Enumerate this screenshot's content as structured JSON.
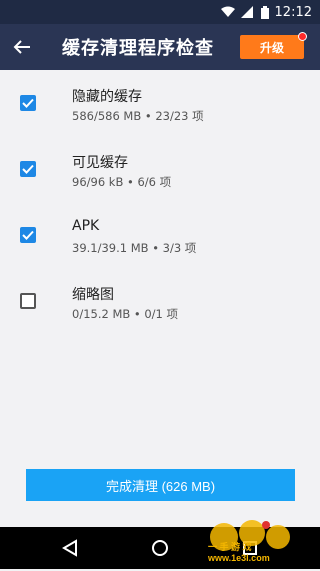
{
  "status_bar": {
    "time": "12:12",
    "icons": [
      "wifi-icon",
      "signal-icon",
      "battery-icon"
    ]
  },
  "header": {
    "back_icon": "arrow-left-icon",
    "title": "缓存清理程序检查",
    "upgrade_label": "升级"
  },
  "items": [
    {
      "title": "隐藏的缓存",
      "subtitle": "586/586 MB • 23/23 项",
      "checked": true
    },
    {
      "title": "可见缓存",
      "subtitle": "96/96 kB • 6/6 项",
      "checked": true
    },
    {
      "title": "APK",
      "subtitle": "39.1/39.1 MB • 3/3 项",
      "checked": true
    },
    {
      "title": "缩略图",
      "subtitle": "0/15.2 MB • 0/1 项",
      "checked": false
    }
  ],
  "finish_button_label": "完成清理 (626 MB)",
  "nav": [
    "back-triangle-icon",
    "home-circle-icon",
    "recents-square-icon"
  ],
  "watermark": {
    "text": "一 手 游 戏 www.1e3l.com"
  },
  "colors": {
    "appbar": "#2a3554",
    "statusbar": "#1f2a44",
    "upgrade": "#ff7a1a",
    "checkbox": "#1e88e5",
    "finish_button": "#1aa3f5"
  }
}
